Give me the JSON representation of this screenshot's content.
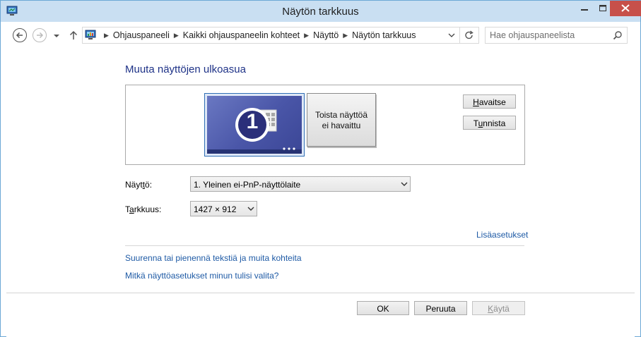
{
  "window": {
    "title": "Näytön tarkkuus"
  },
  "address": {
    "crumbs": [
      "Ohjauspaneeli",
      "Kaikki ohjauspaneelin kohteet",
      "Näyttö",
      "Näytön tarkkuus"
    ],
    "search_placeholder": "Hae ohjauspaneelista"
  },
  "main": {
    "heading": "Muuta näyttöjen ulkoasua",
    "monitor1_number": "1",
    "monitor2_label_line1": "Toista näyttöä",
    "monitor2_label_line2": "ei havaittu",
    "detect_button": {
      "prefix": "",
      "accel": "H",
      "rest": "avaitse"
    },
    "identify_button": {
      "prefix": "T",
      "accel": "u",
      "rest": "nnista"
    },
    "display_label": {
      "prefix": "Näyt",
      "accel": "t",
      "rest": "ö:"
    },
    "display_value": "1. Yleinen ei-PnP-näyttölaite",
    "resolution_label": {
      "prefix": "T",
      "accel": "a",
      "rest": "rkkuus:"
    },
    "resolution_value": "1427 × 912",
    "advanced_link": "Lisäasetukset",
    "textsize_link": "Suurenna tai pienennä tekstiä ja muita kohteita",
    "which_link": "Mitkä näyttöasetukset minun tulisi valita?"
  },
  "footer": {
    "ok": "OK",
    "cancel": "Peruuta",
    "apply": {
      "prefix": "",
      "accel": "K",
      "rest": "äytä"
    }
  },
  "colors": {
    "title_bar": "#c9dff2",
    "close_button": "#c7504a",
    "heading": "#1e3287",
    "link": "#1e5aa5"
  }
}
